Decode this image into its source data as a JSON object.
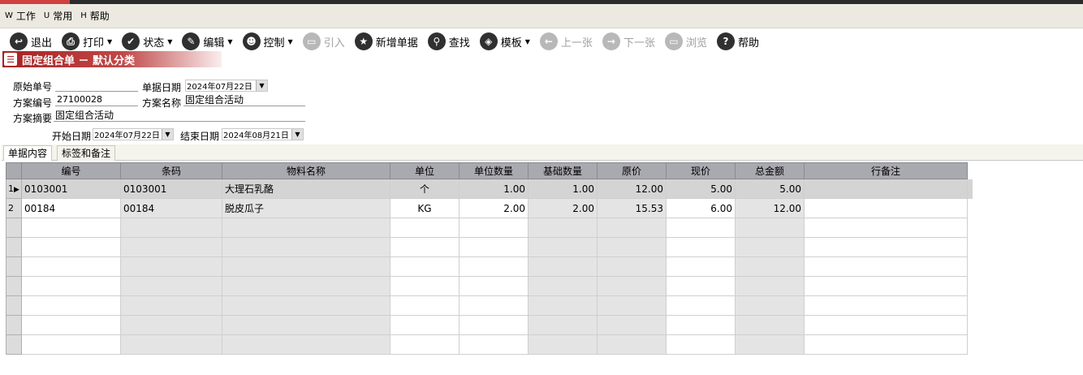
{
  "menu": [
    {
      "key": "W",
      "label": "工作"
    },
    {
      "key": "U",
      "label": "常用"
    },
    {
      "key": "H",
      "label": "帮助"
    }
  ],
  "toolbar": [
    {
      "label": "退出",
      "icon": "exit-icon",
      "glyph": "↩",
      "dropdown": false,
      "enabled": true
    },
    {
      "label": "打印",
      "icon": "print-icon",
      "glyph": "⎙",
      "dropdown": true,
      "enabled": true
    },
    {
      "label": "状态",
      "icon": "status-check-icon",
      "glyph": "✔",
      "dropdown": true,
      "enabled": true
    },
    {
      "label": "编辑",
      "icon": "edit-pencil-icon",
      "glyph": "✎",
      "dropdown": true,
      "enabled": true
    },
    {
      "label": "控制",
      "icon": "control-user-icon",
      "glyph": "☻",
      "dropdown": true,
      "enabled": true
    },
    {
      "label": "引入",
      "icon": "import-folder-icon",
      "glyph": "▭",
      "dropdown": false,
      "enabled": false
    },
    {
      "label": "新增单据",
      "icon": "new-star-icon",
      "glyph": "★",
      "dropdown": false,
      "enabled": true
    },
    {
      "label": "查找",
      "icon": "search-icon",
      "glyph": "⚲",
      "dropdown": false,
      "enabled": true
    },
    {
      "label": "模板",
      "icon": "template-icon",
      "glyph": "◈",
      "dropdown": true,
      "enabled": true
    },
    {
      "label": "上一张",
      "icon": "prev-arrow-icon",
      "glyph": "←",
      "dropdown": false,
      "enabled": false
    },
    {
      "label": "下一张",
      "icon": "next-arrow-icon",
      "glyph": "→",
      "dropdown": false,
      "enabled": false
    },
    {
      "label": "浏览",
      "icon": "browse-folder-icon",
      "glyph": "▭",
      "dropdown": false,
      "enabled": false
    },
    {
      "label": "帮助",
      "icon": "help-icon",
      "glyph": "?",
      "dropdown": false,
      "enabled": true
    }
  ],
  "title": "固定组合单 － 默认分类",
  "form": {
    "original_no_label": "原始单号",
    "original_no_value": "",
    "doc_date_label": "单据日期",
    "doc_date_value": "2024年07月22日",
    "plan_no_label": "方案编号",
    "plan_no_value": "27100028",
    "plan_name_label": "方案名称",
    "plan_name_value": "固定组合活动",
    "plan_summary_label": "方案摘要",
    "plan_summary_value": "固定组合活动",
    "start_date_label": "开始日期",
    "start_date_value": "2024年07月22日",
    "end_date_label": "结束日期",
    "end_date_value": "2024年08月21日"
  },
  "tabs": [
    "单据内容",
    "标签和备注"
  ],
  "grid": {
    "columns": [
      "编号",
      "条码",
      "物料名称",
      "单位",
      "单位数量",
      "基础数量",
      "原价",
      "现价",
      "总金额",
      "行备注"
    ],
    "rows": [
      {
        "rowno": "1",
        "cells": [
          "0103001",
          "0103001",
          "大理石乳酪",
          "个",
          "1.00",
          "1.00",
          "12.00",
          "5.00",
          "5.00",
          ""
        ]
      },
      {
        "rowno": "2",
        "cells": [
          "00184",
          "00184",
          "脱皮瓜子",
          "KG",
          "2.00",
          "2.00",
          "15.53",
          "6.00",
          "12.00",
          ""
        ]
      }
    ]
  }
}
